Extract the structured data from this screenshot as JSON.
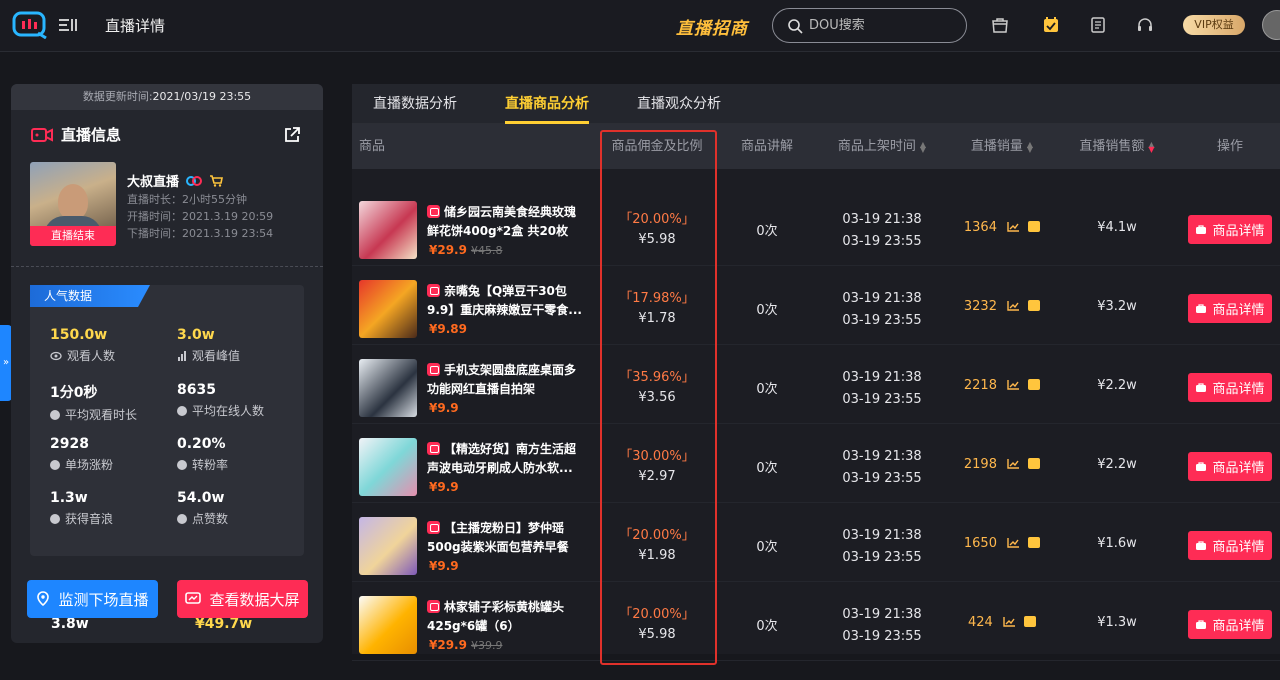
{
  "header": {
    "page_title": "直播详情",
    "brand": "直播招商",
    "search_placeholder": "DOU搜索",
    "vip_label": "VIP权益"
  },
  "left": {
    "update_prefix": "数据更新时间:",
    "update_time": "2021/03/19 23:55",
    "section_title": "直播信息",
    "cover_badge": "直播结束",
    "anchor_name": "大叔直播",
    "duration_label": "直播时长：",
    "duration": "2小时55分钟",
    "start_label": "开播时间：",
    "start": "2021.3.19 20:59",
    "end_label": "下播时间：",
    "end": "2021.3.19 23:54",
    "stats_tag": "人气数据",
    "stats": [
      {
        "value": "150.0w",
        "label": "观看人数"
      },
      {
        "value": "3.0w",
        "label": "观看峰值"
      },
      {
        "value": "1分0秒",
        "label": "平均观看时长"
      },
      {
        "value": "8635",
        "label": "平均在线人数"
      },
      {
        "value": "2928",
        "label": "单场涨粉"
      },
      {
        "value": "0.20%",
        "label": "转粉率"
      },
      {
        "value": "1.3w",
        "label": "获得音浪"
      },
      {
        "value": "54.0w",
        "label": "点赞数"
      }
    ],
    "peek_left": "3.8w",
    "peek_right": "¥49.7w",
    "btn_monitor": "监测下场直播",
    "btn_screen": "查看数据大屏"
  },
  "tabs": [
    "直播数据分析",
    "直播商品分析",
    "直播观众分析"
  ],
  "columns": {
    "product": "商品",
    "commission": "商品佣金及比例",
    "explain": "商品讲解",
    "listed": "商品上架时间",
    "sales": "直播销量",
    "revenue": "直播销售额",
    "action": "操作"
  },
  "detail_label": "商品详情",
  "rows": [
    {
      "name": "储乡园云南美食经典玫瑰鲜花饼400g*2盒 共20枚",
      "price": "¥29.9",
      "orig": "¥45.8",
      "rate": "「20.00%」",
      "comm": "¥5.98",
      "explain": "0次",
      "t1": "03-19 21:38",
      "t2": "03-19 23:55",
      "sales": "1364",
      "revenue": "¥4.1w"
    },
    {
      "name": "亲嘴兔【Q弹豆干30包9.9】重庆麻辣嫩豆干零食...",
      "price": "¥9.89",
      "orig": "",
      "rate": "「17.98%」",
      "comm": "¥1.78",
      "explain": "0次",
      "t1": "03-19 21:38",
      "t2": "03-19 23:55",
      "sales": "3232",
      "revenue": "¥3.2w"
    },
    {
      "name": "手机支架圆盘底座桌面多功能网红直播自拍架",
      "price": "¥9.9",
      "orig": "",
      "rate": "「35.96%」",
      "comm": "¥3.56",
      "explain": "0次",
      "t1": "03-19 21:38",
      "t2": "03-19 23:55",
      "sales": "2218",
      "revenue": "¥2.2w"
    },
    {
      "name": "【精选好货】南方生活超声波电动牙刷成人防水软...",
      "price": "¥9.9",
      "orig": "",
      "rate": "「30.00%」",
      "comm": "¥2.97",
      "explain": "0次",
      "t1": "03-19 21:38",
      "t2": "03-19 23:55",
      "sales": "2198",
      "revenue": "¥2.2w"
    },
    {
      "name": "【主播宠粉日】梦仲瑶500g装紫米面包营养早餐",
      "price": "¥9.9",
      "orig": "",
      "rate": "「20.00%」",
      "comm": "¥1.98",
      "explain": "0次",
      "t1": "03-19 21:38",
      "t2": "03-19 23:55",
      "sales": "1650",
      "revenue": "¥1.6w"
    },
    {
      "name": "林家铺子彩标黄桃罐头425g*6罐（6）",
      "price": "¥29.9",
      "orig": "¥39.9",
      "rate": "「20.00%」",
      "comm": "¥5.98",
      "explain": "0次",
      "t1": "03-19 21:38",
      "t2": "03-19 23:55",
      "sales": "424",
      "revenue": "¥1.3w"
    }
  ]
}
